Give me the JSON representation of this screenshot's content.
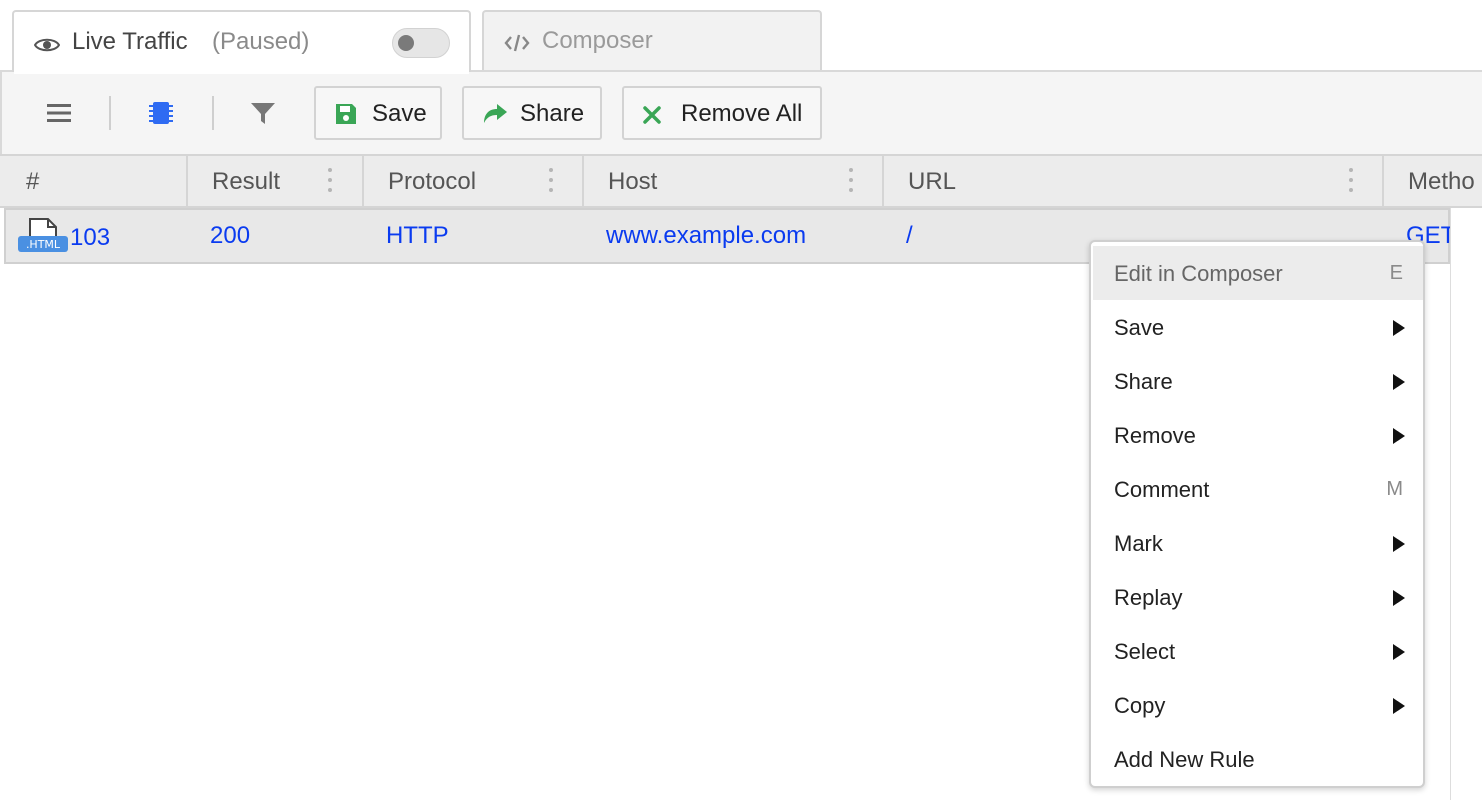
{
  "tabs": {
    "live_traffic": {
      "label": "Live Traffic",
      "status": "(Paused)",
      "icon": "eye-icon",
      "toggle_on": false
    },
    "composer": {
      "label": "Composer",
      "icon": "code-icon"
    }
  },
  "toolbar": {
    "menu_icon": "hamburger-menu-icon",
    "capture_icon": "chip-icon",
    "filter_icon": "filter-icon",
    "save_label": "Save",
    "share_label": "Share",
    "remove_all_label": "Remove All"
  },
  "grid": {
    "columns": [
      "#",
      "Result",
      "Protocol",
      "Host",
      "URL",
      "Metho"
    ],
    "rows": [
      {
        "file_type": ".HTML",
        "id": "103",
        "result": "200",
        "protocol": "HTTP",
        "host": "www.example.com",
        "url": "/",
        "method": "GET"
      }
    ]
  },
  "context_menu": {
    "items": [
      {
        "label": "Edit in Composer",
        "shortcut": "E",
        "submenu": false
      },
      {
        "label": "Save",
        "shortcut": "",
        "submenu": true
      },
      {
        "label": "Share",
        "shortcut": "",
        "submenu": true
      },
      {
        "label": "Remove",
        "shortcut": "",
        "submenu": true
      },
      {
        "label": "Comment",
        "shortcut": "M",
        "submenu": false
      },
      {
        "label": "Mark",
        "shortcut": "",
        "submenu": true
      },
      {
        "label": "Replay",
        "shortcut": "",
        "submenu": true
      },
      {
        "label": "Select",
        "shortcut": "",
        "submenu": true
      },
      {
        "label": "Copy",
        "shortcut": "",
        "submenu": true
      },
      {
        "label": "Add New Rule",
        "shortcut": "",
        "submenu": false
      }
    ]
  },
  "colors": {
    "link_blue": "#0a3bf0",
    "save_green": "#3aa656",
    "chip_blue": "#2f6bf2"
  }
}
